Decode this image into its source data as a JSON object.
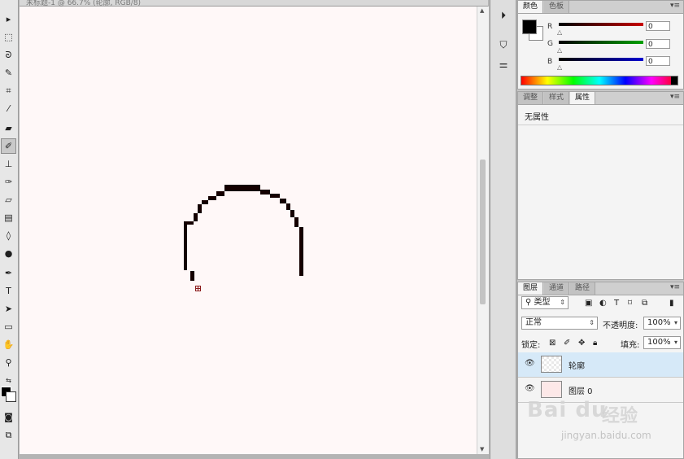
{
  "document": {
    "tab_title": "未标题-1 @ 66.7% (轮廓, RGB/8)"
  },
  "tools": [
    {
      "name": "move",
      "glyph": "▸"
    },
    {
      "name": "marquee",
      "glyph": "⬚"
    },
    {
      "name": "lasso",
      "glyph": "ᘐ"
    },
    {
      "name": "quick-select",
      "glyph": "✎"
    },
    {
      "name": "crop",
      "glyph": "⌗"
    },
    {
      "name": "eyedropper",
      "glyph": "⁄"
    },
    {
      "name": "healing",
      "glyph": "▰"
    },
    {
      "name": "brush",
      "glyph": "✐"
    },
    {
      "name": "stamp",
      "glyph": "⊥"
    },
    {
      "name": "history-brush",
      "glyph": "✑"
    },
    {
      "name": "eraser",
      "glyph": "▱"
    },
    {
      "name": "gradient",
      "glyph": "▤"
    },
    {
      "name": "blur",
      "glyph": "◊"
    },
    {
      "name": "dodge",
      "glyph": "●"
    },
    {
      "name": "pen",
      "glyph": "✒"
    },
    {
      "name": "type",
      "glyph": "T"
    },
    {
      "name": "path-select",
      "glyph": "➤"
    },
    {
      "name": "shape",
      "glyph": "▭"
    },
    {
      "name": "hand",
      "glyph": "✋"
    },
    {
      "name": "zoom",
      "glyph": "⚲"
    }
  ],
  "color_panel": {
    "tabs": [
      "颜色",
      "色板"
    ],
    "channels": [
      {
        "label": "R",
        "value": "0",
        "color": "#c80000"
      },
      {
        "label": "G",
        "value": "0",
        "color": "#00a000"
      },
      {
        "label": "B",
        "value": "0",
        "color": "#0000d0"
      }
    ]
  },
  "props_panel": {
    "tabs": [
      "调整",
      "样式",
      "属性"
    ],
    "content": "无属性"
  },
  "layers_panel": {
    "tabs": [
      "图层",
      "通道",
      "路径"
    ],
    "filter_label": "类型",
    "blend_mode": "正常",
    "opacity_label": "不透明度:",
    "opacity_value": "100%",
    "lock_label": "锁定:",
    "fill_label": "填充:",
    "fill_value": "100%",
    "layers": [
      {
        "name": "轮廓",
        "active": true
      },
      {
        "name": "图层 0",
        "active": false
      }
    ]
  },
  "watermark": {
    "logo": "Bai du",
    "name_cn": "经验",
    "url": "jingyan.baidu.com"
  }
}
